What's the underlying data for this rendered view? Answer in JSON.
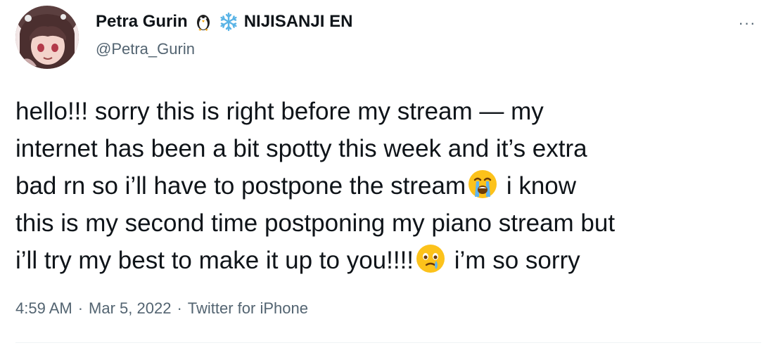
{
  "author": {
    "display_name": "Petra Gurin",
    "badge_icons": [
      "penguin-icon",
      "snowflake-icon"
    ],
    "affiliation": "NIJISANJI EN",
    "handle": "@Petra_Gurin"
  },
  "menu": {
    "more_label": "···"
  },
  "tweet": {
    "line1": "hello!!! sorry this is right before my stream — my",
    "line2": "internet has been a bit spotty this week and it’s extra",
    "line3_before_emoji": "bad rn so i’ll have to postpone the stream",
    "line3_emoji": "loudly-crying-face-emoji",
    "line3_after_emoji": " i know",
    "line4": "this is my second time postponing my piano stream but",
    "line5_before_emoji": "i’ll try my best to make it up to you!!!!",
    "line5_emoji": "face-holding-back-tears-emoji",
    "line5_after_emoji": " i’m so sorry"
  },
  "meta": {
    "time": "4:59 AM",
    "separator": "·",
    "date": "Mar 5, 2022",
    "app": "Twitter for iPhone"
  },
  "colors": {
    "text_primary": "#0f1419",
    "text_secondary": "#536471",
    "divider": "#eff3f4",
    "snowflake": "#5ab4e6",
    "emoji_yellow": "#fcc21b"
  }
}
